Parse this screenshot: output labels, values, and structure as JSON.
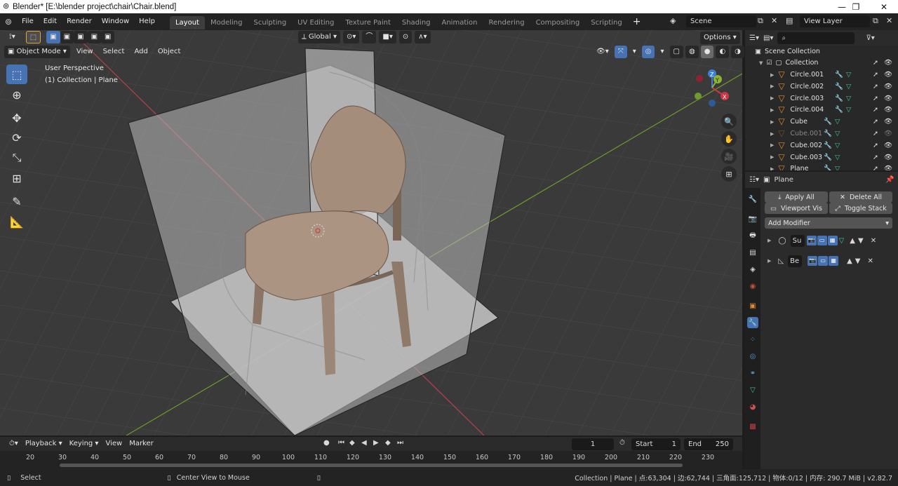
{
  "window": {
    "title": "Blender* [E:\\blender project\\chair\\Chair.blend]"
  },
  "menu": [
    "File",
    "Edit",
    "Render",
    "Window",
    "Help"
  ],
  "workspaces": [
    "Layout",
    "Modeling",
    "Sculpting",
    "UV Editing",
    "Texture Paint",
    "Shading",
    "Animation",
    "Rendering",
    "Compositing",
    "Scripting"
  ],
  "active_workspace": "Layout",
  "scene": {
    "name": "Scene",
    "view_layer": "View Layer"
  },
  "viewport": {
    "mode": "Object Mode",
    "menus": [
      "View",
      "Select",
      "Add",
      "Object"
    ],
    "orientation": "Global",
    "options": "Options",
    "info_line1": "User Perspective",
    "info_line2": "(1) Collection | Plane",
    "gizmo": {
      "x": "X",
      "y": "Y",
      "z": "Z"
    }
  },
  "outliner": {
    "root": "Scene Collection",
    "collection": "Collection",
    "items": [
      "Circle.001",
      "Circle.002",
      "Circle.003",
      "Circle.004",
      "Cube",
      "Cube.001",
      "Cube.002",
      "Cube.003",
      "Plane"
    ]
  },
  "properties": {
    "object_name": "Plane",
    "apply_all": "Apply All",
    "delete_all": "Delete All",
    "viewport_vis": "Viewport Vis",
    "toggle_stack": "Toggle Stack",
    "add_modifier": "Add Modifier",
    "modifiers": [
      "Su",
      "Be"
    ]
  },
  "timeline": {
    "menus": [
      "Playback",
      "Keying",
      "View",
      "Marker"
    ],
    "current_frame": "1",
    "start_label": "Start",
    "start": "1",
    "end_label": "End",
    "end": "250",
    "ticks": [
      "20",
      "30",
      "40",
      "50",
      "60",
      "70",
      "80",
      "90",
      "100",
      "110",
      "120",
      "130",
      "140",
      "150",
      "160",
      "170",
      "180",
      "190",
      "200",
      "210",
      "220",
      "230"
    ]
  },
  "status": {
    "select": "Select",
    "center_view": "Center View to Mouse",
    "stats": "Collection | Plane | 点:63,304 | 边:62,744 | 三角面:125,712 | 物体:0/12 | 内存: 290.7 MiB | v2.82.7"
  },
  "colors": {
    "accent": "#4772b3",
    "mesh": "#e38a2c",
    "bg": "#3a3a3a"
  }
}
